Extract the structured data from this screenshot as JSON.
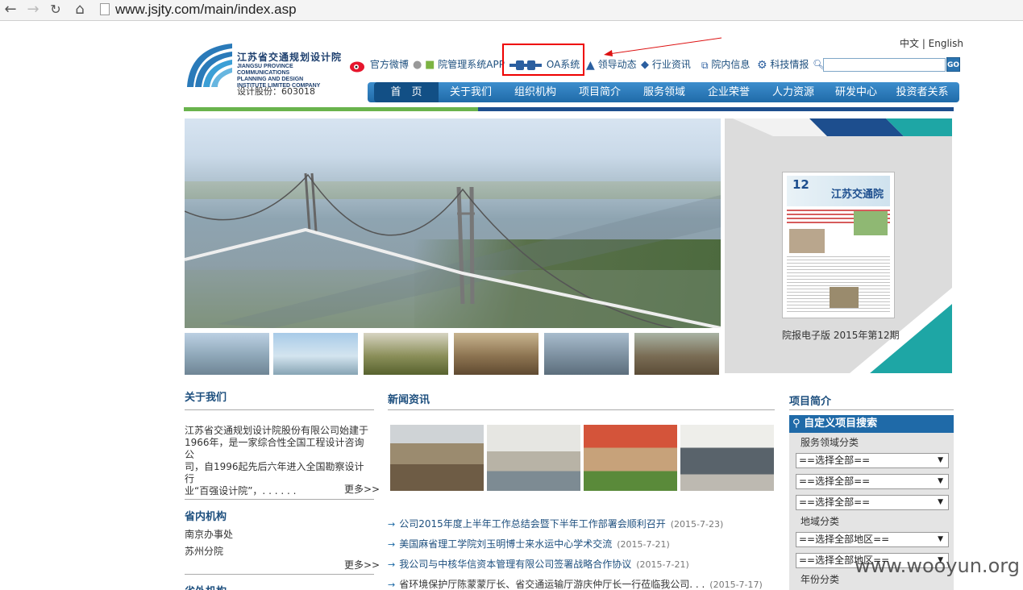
{
  "browser": {
    "url": "www.jsjty.com/main/index.asp"
  },
  "header": {
    "logo_cn": "江苏省交通规划设计院",
    "logo_en_lines": [
      "JIANGSU PROVINCE COMMUNICATIONS",
      "PLANNING AND DESIGN",
      "INSTITUTE LIMITED COMPANY"
    ],
    "stock": "设计股份：603018",
    "lang": "中文 | English",
    "top_links": [
      "官方微博",
      "院管理系统APP",
      "OA系统",
      "领导动态",
      "行业资讯",
      "院内信息",
      "科技情报"
    ],
    "go": "GO"
  },
  "nav": [
    "首　页",
    "关于我们",
    "组织机构",
    "项目简介",
    "服务领域",
    "企业荣誉",
    "人力资源",
    "研发中心",
    "投资者关系"
  ],
  "paper": {
    "caption": "院报电子版 2015年第12期",
    "masthead": "江苏交通院",
    "issue": "12"
  },
  "about": {
    "title": "关于我们",
    "lines": [
      "江苏省交通规划设计院股份有限公司始建于",
      "1966年，是一家综合性全国工程设计咨询公",
      "司，自1996起先后六年进入全国勘察设计行",
      "业“百强设计院”，. . . . . ."
    ],
    "more": "更多>>"
  },
  "province": {
    "title": "省内机构",
    "items": [
      "南京办事处",
      "苏州分院"
    ],
    "more": "更多>>"
  },
  "outside": {
    "title": "省外机构"
  },
  "news": {
    "title": "新闻资讯",
    "items": [
      {
        "text": "公司2015年度上半年工作总结会暨下半年工作部署会顺利召开",
        "date": "(2015-7-23)"
      },
      {
        "text": "美国麻省理工学院刘玉明博士来水运中心学术交流",
        "date": "(2015-7-21)"
      },
      {
        "text": "我公司与中核华信资本管理有限公司签署战略合作协议",
        "date": "(2015-7-21)"
      },
      {
        "text": "省环境保护厅陈蒙蒙厅长、省交通运输厅游庆仲厅长一行莅临我公司. . .",
        "date": "(2015-7-17)"
      }
    ]
  },
  "projects": {
    "title": "项目简介",
    "search_title": "自定义项目搜索",
    "service_label": "服务领域分类",
    "region_label": "地域分类",
    "year_label": "年份分类",
    "select_all": "==选择全部==",
    "select_region": "==选择全部地区=="
  },
  "watermark": "www.wooyun.org",
  "colors": {
    "accent": "#1f6aa8",
    "green": "#69b34c",
    "navy": "#1d4e8e",
    "oa_highlight": "#e00000"
  }
}
